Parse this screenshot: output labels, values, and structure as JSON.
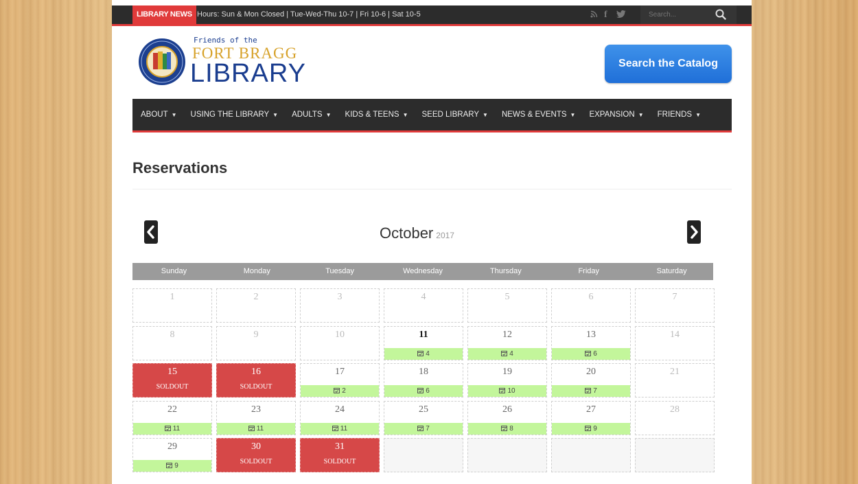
{
  "topbar": {
    "news_label": "LIBRARY NEWS",
    "news_text": "Hours: Sun & Mon Closed | Tue-Wed-Thu 10-7 | Fri 10-6 | Sat 10-5",
    "search_placeholder": "Search...",
    "social_icons": [
      "rss-icon",
      "facebook-icon",
      "twitter-icon"
    ]
  },
  "header": {
    "logo_line1": "Friends of the",
    "logo_line2": "FORT BRAGG",
    "logo_line3": "LIBRARY",
    "catalog_button": "Search the Catalog"
  },
  "nav": {
    "items": [
      {
        "label": "ABOUT"
      },
      {
        "label": "USING THE LIBRARY"
      },
      {
        "label": "ADULTS"
      },
      {
        "label": "KIDS & TEENS"
      },
      {
        "label": "SEED LIBRARY"
      },
      {
        "label": "NEWS & EVENTS"
      },
      {
        "label": "EXPANSION"
      },
      {
        "label": "FRIENDS"
      }
    ]
  },
  "page": {
    "title": "Reservations"
  },
  "calendar": {
    "month": "October",
    "year": "2017",
    "weekdays": [
      "Sunday",
      "Monday",
      "Tuesday",
      "Wednesday",
      "Thursday",
      "Friday",
      "Saturday"
    ],
    "soldout_label": "SOLDOUT",
    "weeks": [
      [
        {
          "day": "1",
          "state": "past"
        },
        {
          "day": "2",
          "state": "past"
        },
        {
          "day": "3",
          "state": "past"
        },
        {
          "day": "4",
          "state": "past"
        },
        {
          "day": "5",
          "state": "past"
        },
        {
          "day": "6",
          "state": "past"
        },
        {
          "day": "7",
          "state": "past"
        }
      ],
      [
        {
          "day": "8",
          "state": "past"
        },
        {
          "day": "9",
          "state": "past"
        },
        {
          "day": "10",
          "state": "past"
        },
        {
          "day": "11",
          "state": "today",
          "count": "4"
        },
        {
          "day": "12",
          "state": "open",
          "count": "4"
        },
        {
          "day": "13",
          "state": "open",
          "count": "6"
        },
        {
          "day": "14",
          "state": "past"
        }
      ],
      [
        {
          "day": "15",
          "state": "soldout"
        },
        {
          "day": "16",
          "state": "soldout"
        },
        {
          "day": "17",
          "state": "open",
          "count": "2"
        },
        {
          "day": "18",
          "state": "open",
          "count": "6"
        },
        {
          "day": "19",
          "state": "open",
          "count": "10"
        },
        {
          "day": "20",
          "state": "open",
          "count": "7"
        },
        {
          "day": "21",
          "state": "past"
        }
      ],
      [
        {
          "day": "22",
          "state": "open",
          "count": "11"
        },
        {
          "day": "23",
          "state": "open",
          "count": "11"
        },
        {
          "day": "24",
          "state": "open",
          "count": "11"
        },
        {
          "day": "25",
          "state": "open",
          "count": "7"
        },
        {
          "day": "26",
          "state": "open",
          "count": "8"
        },
        {
          "day": "27",
          "state": "open",
          "count": "9"
        },
        {
          "day": "28",
          "state": "past"
        }
      ],
      [
        {
          "day": "29",
          "state": "open",
          "count": "9"
        },
        {
          "day": "30",
          "state": "soldout"
        },
        {
          "day": "31",
          "state": "soldout"
        },
        {
          "day": "",
          "state": "blank"
        },
        {
          "day": "",
          "state": "blank"
        },
        {
          "day": "",
          "state": "blank"
        },
        {
          "day": "",
          "state": "blank"
        }
      ]
    ]
  },
  "colors": {
    "accent_red": "#e03a3a",
    "available_green": "#c3f69b",
    "soldout_red": "#d64848",
    "catalog_blue": "#2a7fe0"
  }
}
